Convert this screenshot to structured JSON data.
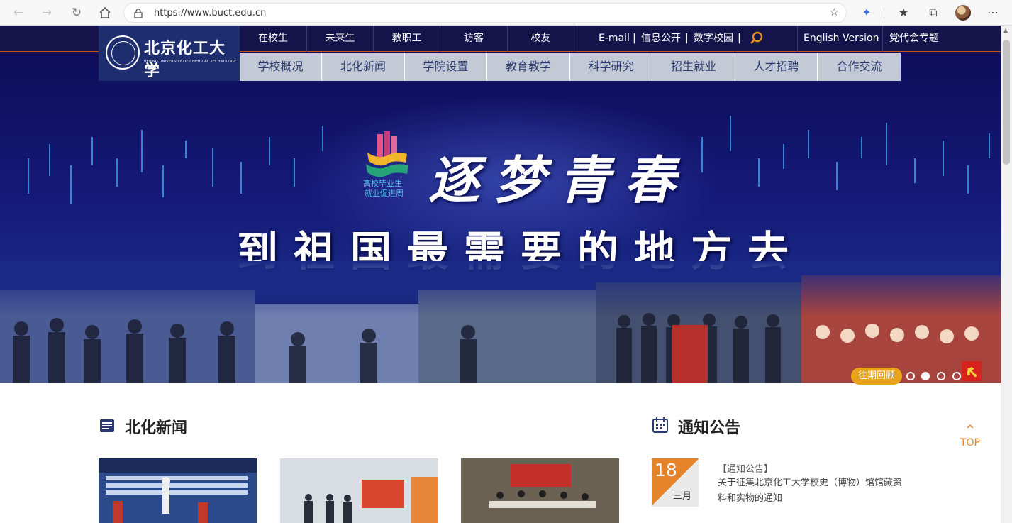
{
  "browser": {
    "url": "https://www.buct.edu.cn"
  },
  "header": {
    "logo_cn": "北京化工大学",
    "logo_en": "BEIJING UNIVERSITY OF CHEMICAL TECHNOLOGY",
    "audience_links": [
      "在校生",
      "未来生",
      "教职工",
      "访客",
      "校友"
    ],
    "email": "E-mail",
    "sep1": "|",
    "info_public": "信息公开",
    "sep2": "|",
    "digital_campus": "数字校园",
    "sep3": "|",
    "english": "English Version",
    "party": "党代会专题",
    "main_nav": [
      "学校概况",
      "北化新闻",
      "学院设置",
      "教育教学",
      "科学研究",
      "招生就业",
      "人才招聘",
      "合作交流"
    ]
  },
  "hero": {
    "logo_line1": "高校毕业生",
    "logo_line2": "就业促进周",
    "title": "逐梦青春",
    "subtitle": "到祖国最需要的地方去",
    "review_badge": "往期回顾",
    "slide_count": 4,
    "active_slide": 2
  },
  "news": {
    "title": "北化新闻"
  },
  "notice": {
    "title": "通知公告",
    "items": [
      {
        "day": "18",
        "month": "三月",
        "tag": "【通知公告】",
        "text": "关于征集北京化工大学校史（博物）馆馆藏资料和实物的通知"
      }
    ]
  },
  "back_to_top": "TOP",
  "colors": {
    "topbar": "#14144a",
    "logo_bg": "#1d2d6e",
    "subnav": "#c3c9d5",
    "accent": "#e4832a",
    "badge": "#e8a318"
  }
}
